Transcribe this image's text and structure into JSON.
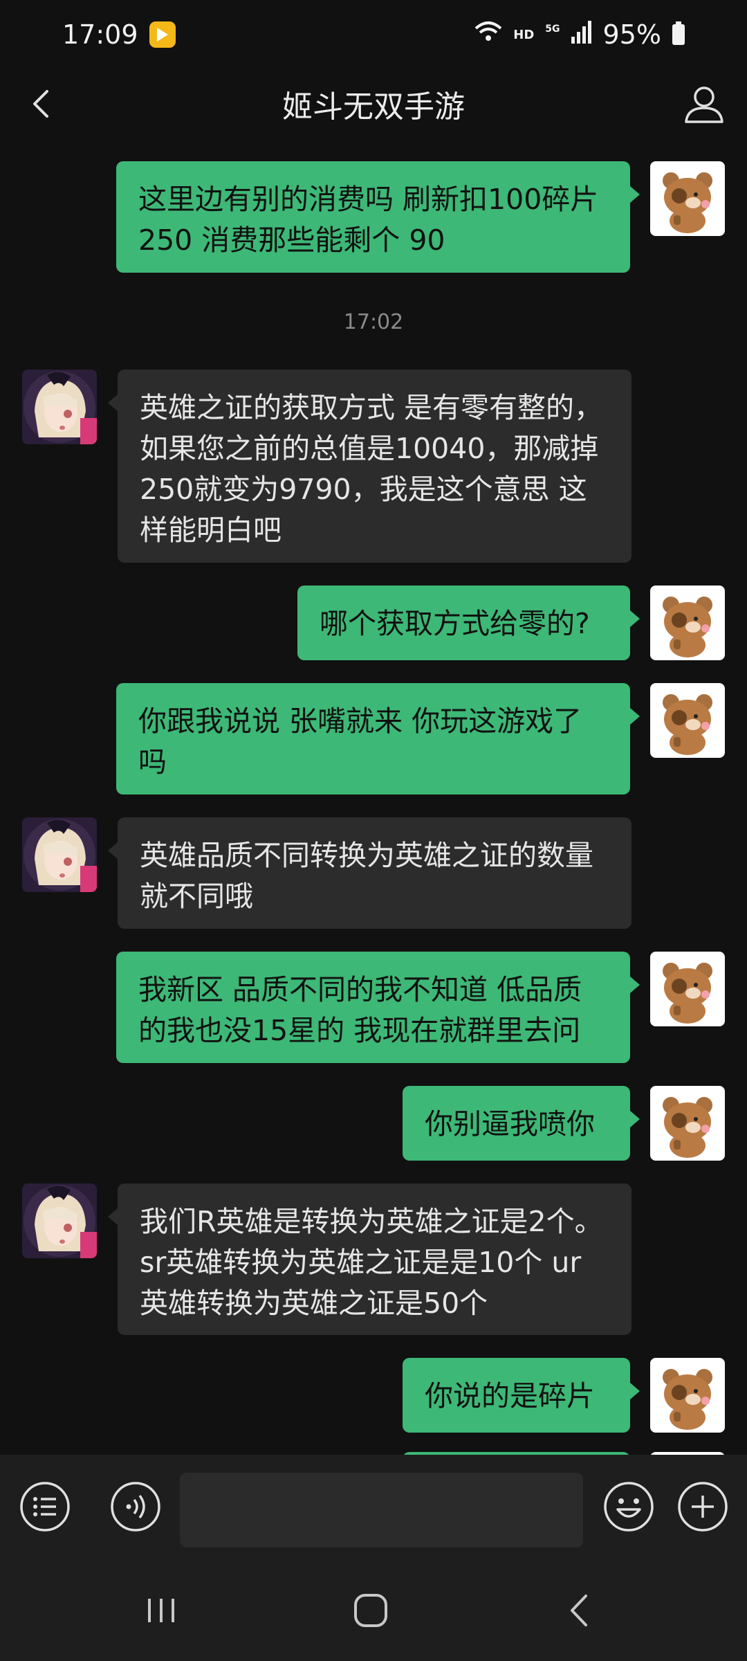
{
  "status_bar": {
    "time": "17:09",
    "network_hd": "HD",
    "network_5g": "5G",
    "battery": "95%"
  },
  "header": {
    "title": "姬斗无双手游"
  },
  "messages": [
    {
      "side": "out",
      "text": "这里边有别的消费吗 刷新扣100碎片 250 消费那些能剩个 90"
    },
    {
      "timestamp": "17:02"
    },
    {
      "side": "in",
      "text": "英雄之证的获取方式 是有零有整的，如果您之前的总值是10040，那减掉250就变为9790，我是这个意思 这样能明白吧"
    },
    {
      "side": "out",
      "text": "哪个获取方式给零的?"
    },
    {
      "side": "out",
      "text": "你跟我说说 张嘴就来 你玩这游戏了吗"
    },
    {
      "side": "in",
      "text": "英雄品质不同转换为英雄之证的数量就不同哦"
    },
    {
      "side": "out",
      "text": "我新区 品质不同的我不知道 低品质的我也没15星的 我现在就群里去问"
    },
    {
      "side": "out",
      "text": "你别逼我喷你"
    },
    {
      "side": "in",
      "text": "我们R英雄是转换为英雄之证是2个。sr英雄转换为英雄之证是是10个 ur英雄转换为英雄之证是50个"
    },
    {
      "side": "out",
      "text": "你说的是碎片"
    }
  ],
  "input_bar": {
    "input_value": "",
    "icons": [
      "menu-icon",
      "voice-icon",
      "emoji-icon",
      "plus-icon"
    ]
  },
  "nav_bar": {
    "icons": [
      "recent-apps-icon",
      "home-icon",
      "back-icon"
    ]
  },
  "colors": {
    "background": "#111111",
    "outgoing_bubble": "#3db876",
    "incoming_bubble": "#2c2c2c",
    "bars": "#1e1e1e"
  }
}
